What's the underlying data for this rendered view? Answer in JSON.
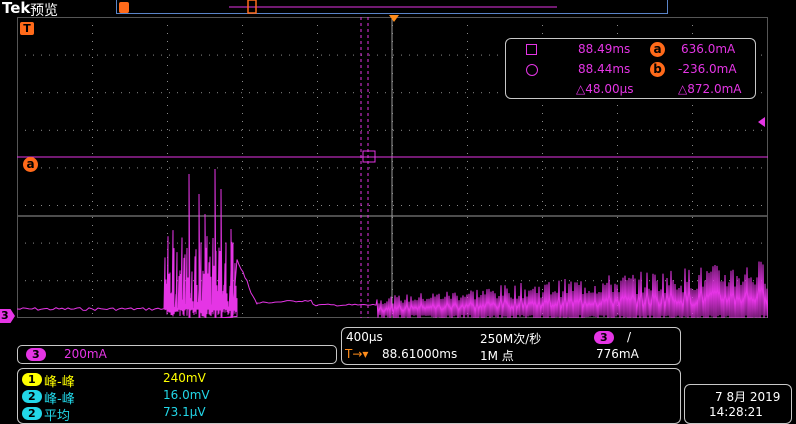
{
  "header": {
    "brand": "Tek",
    "mode": "预览"
  },
  "colors": {
    "ch1": "#ffff00",
    "ch2": "#22d7e8",
    "ch3": "#e535e5",
    "ref": "#ff6a1a",
    "grid": "#8a8a8a"
  },
  "markers": {
    "trigger": "T",
    "cursor_a": "a",
    "channel3": "3"
  },
  "cursor_readout": {
    "t1": "88.49ms",
    "t2": "88.44ms",
    "dt": "△48.00µs",
    "a_label": "a",
    "a_value": "636.0mA",
    "b_label": "b",
    "b_value": "-236.0mA",
    "dv": "△872.0mA"
  },
  "channel_scale": {
    "channel": "3",
    "value": "200mA"
  },
  "horizontal": {
    "time_div": "400µs",
    "sample_rate": "250M次/秒",
    "record": "1M 点",
    "trigger_pos_prefix": "T→▾",
    "trigger_pos": "88.61000ms",
    "trigger_channel": "3",
    "trigger_slope": "/",
    "trigger_level": "776mA"
  },
  "measurements": [
    {
      "channel": "1",
      "name": "峰-峰",
      "value": "240mV"
    },
    {
      "channel": "2",
      "name": "峰-峰",
      "value": "16.0mV"
    },
    {
      "channel": "2",
      "name": "平均",
      "value": "73.1µV"
    }
  ],
  "datetime": {
    "date": "7 8月 2019",
    "time": "14:28:21"
  }
}
